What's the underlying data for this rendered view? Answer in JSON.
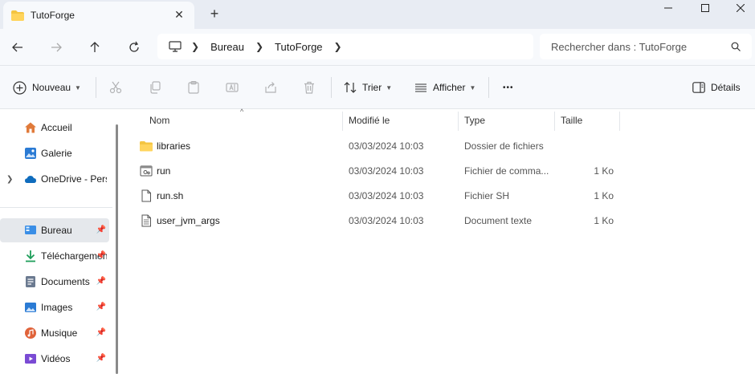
{
  "window": {
    "tab_title": "TutoForge",
    "tab_close": "✕",
    "new_tab": "+"
  },
  "navbar": {
    "breadcrumb": [
      "Bureau",
      "TutoForge"
    ],
    "search_placeholder": "Rechercher dans : TutoForge"
  },
  "toolbar": {
    "new_label": "Nouveau",
    "sort_label": "Trier",
    "view_label": "Afficher",
    "more_label": "•••",
    "details_label": "Détails"
  },
  "sidebar": {
    "items": [
      {
        "label": "Accueil",
        "icon": "home-icon",
        "color": "#e07a3a"
      },
      {
        "label": "Galerie",
        "icon": "gallery-icon",
        "color": "#2b7bd4"
      },
      {
        "label": "OneDrive - Personal",
        "icon": "cloud-icon",
        "color": "#0f6cbd"
      },
      {
        "label": "Bureau",
        "icon": "desktop-icon",
        "color": "#3a8ee6",
        "pinned": true
      },
      {
        "label": "Téléchargements",
        "icon": "download-icon",
        "color": "#1e9e5a",
        "pinned": true
      },
      {
        "label": "Documents",
        "icon": "document-icon",
        "color": "#6b7a90",
        "pinned": true
      },
      {
        "label": "Images",
        "icon": "image-icon",
        "color": "#2b7bd4",
        "pinned": true
      },
      {
        "label": "Musique",
        "icon": "music-icon",
        "color": "#e0633a",
        "pinned": true
      },
      {
        "label": "Vidéos",
        "icon": "video-icon",
        "color": "#7a4bd4",
        "pinned": true
      }
    ]
  },
  "columns": {
    "name": "Nom",
    "modified": "Modifié le",
    "type": "Type",
    "size": "Taille"
  },
  "files": [
    {
      "name": "libraries",
      "modified": "03/03/2024 10:03",
      "type": "Dossier de fichiers",
      "size": "",
      "icon": "folder-icon"
    },
    {
      "name": "run",
      "modified": "03/03/2024 10:03",
      "type": "Fichier de comma...",
      "size": "1 Ko",
      "icon": "batch-file-icon"
    },
    {
      "name": "run.sh",
      "modified": "03/03/2024 10:03",
      "type": "Fichier SH",
      "size": "1 Ko",
      "icon": "file-icon"
    },
    {
      "name": "user_jvm_args",
      "modified": "03/03/2024 10:03",
      "type": "Document texte",
      "size": "1 Ko",
      "icon": "text-file-icon"
    }
  ],
  "colors": {
    "folder": "#f4c542",
    "accent": "#0f6cbd",
    "selected": "#e5e8ec"
  }
}
